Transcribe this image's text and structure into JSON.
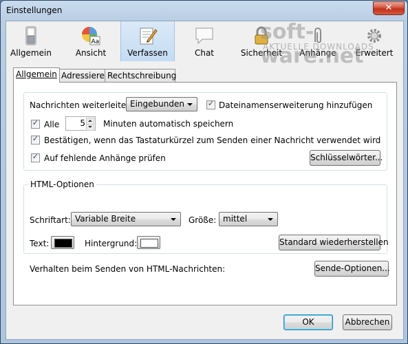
{
  "window": {
    "title": "Einstellungen",
    "close_glyph": "✕"
  },
  "toolbar": {
    "items": [
      {
        "label": "Allgemein",
        "icon": "switch-icon"
      },
      {
        "label": "Ansicht",
        "icon": "palette-icon"
      },
      {
        "label": "Verfassen",
        "icon": "compose-icon",
        "selected": true
      },
      {
        "label": "Chat",
        "icon": "chat-bubble-icon"
      },
      {
        "label": "Sicherheit",
        "icon": "lock-icon"
      },
      {
        "label": "Anhänge",
        "icon": "paperclip-icon"
      },
      {
        "label": "Erweitert",
        "icon": "gear-icon"
      }
    ]
  },
  "watermark": {
    "title": "soft-ware.net",
    "subtitle": "AKTUELLE DOWNLOADS"
  },
  "tabs": [
    {
      "label": "Allgemein",
      "active": true
    },
    {
      "label": "Adressieren"
    },
    {
      "label": "Rechtschreibung"
    }
  ],
  "forwarding": {
    "label": "Nachrichten weiterleiten:",
    "value": "Eingebunden",
    "ext_checkbox_label": "Dateinamenserweiterung hinzufügen",
    "ext_checked": true
  },
  "autosave": {
    "label": "Alle",
    "checked": true,
    "minutes": "5",
    "suffix": "Minuten automatisch speichern"
  },
  "confirm_shortcut": {
    "label": "Bestätigen, wenn das Tastaturkürzel zum Senden einer Nachricht verwendet wird",
    "checked": true
  },
  "attachment_check": {
    "label": "Auf fehlende Anhänge prüfen",
    "checked": true,
    "button": "Schlüsselwörter..."
  },
  "html_options": {
    "legend": "HTML-Optionen",
    "font_label": "Schriftart:",
    "font_value": "Variable Breite",
    "size_label": "Größe:",
    "size_value": "mittel",
    "text_label": "Text:",
    "text_color": "#000000",
    "background_label": "Hintergrund:",
    "background_color": "#ffffff",
    "restore_button": "Standard wiederherstellen"
  },
  "send_behavior": {
    "label": "Verhalten beim Senden von HTML-Nachrichten:",
    "button": "Sende-Optionen..."
  },
  "footer": {
    "ok": "OK",
    "cancel": "Abbrechen"
  },
  "check_glyph": "✓"
}
